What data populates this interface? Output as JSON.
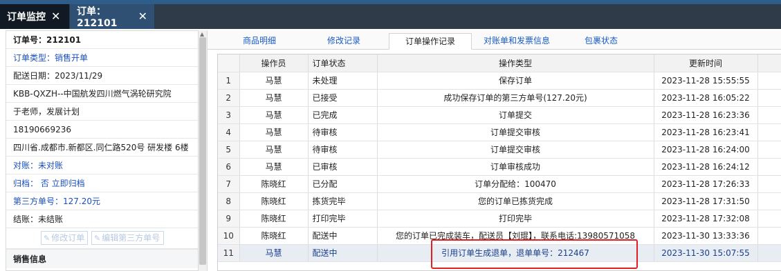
{
  "tabs": [
    {
      "label": "订单监控",
      "close": "✕"
    },
    {
      "label": "订单：212101",
      "close": "✕"
    }
  ],
  "order_info": {
    "order_no": "订单号：212101",
    "order_type": "订单类型：销售开单",
    "delivery_date": "配送日期：2023/11/29",
    "customer": "KBB-QXZH--中国航发四川燃气涡轮研究院",
    "contact": "于老师，发展计划",
    "phone": "18190669236",
    "address": "四川省.成都市.新都区.同仁路520号 研发楼 6楼",
    "reconcile": "对账：未对账",
    "archive": "归档： 否 立即归档",
    "third_party": "第三方单号：127.20元",
    "settle": "结账：未结账",
    "btn_edit_order": "修改订单",
    "btn_edit_third": "编辑第三方单号",
    "section_sales": "销售信息"
  },
  "right_tabs": [
    "商品明细",
    "修改记录",
    "订单操作记录",
    "对账单和发票信息",
    "包裹状态"
  ],
  "active_tab": "订单操作记录",
  "table": {
    "headers": [
      "",
      "操作员",
      "订单状态",
      "操作类型",
      "更新时间"
    ],
    "rows": [
      {
        "idx": "1",
        "operator": "马慧",
        "status": "未处理",
        "action": "保存订单",
        "time": "2023-11-28 15:55:55"
      },
      {
        "idx": "2",
        "operator": "马慧",
        "status": "已接受",
        "action": "成功保存订单的第三方单号(127.20元)",
        "time": "2023-11-28 16:05:22"
      },
      {
        "idx": "3",
        "operator": "马慧",
        "status": "已完成",
        "action": "订单提交",
        "time": "2023-11-28 16:23:36"
      },
      {
        "idx": "4",
        "operator": "马慧",
        "status": "待审核",
        "action": "订单提交审核",
        "time": "2023-11-28 16:23:41"
      },
      {
        "idx": "5",
        "operator": "马慧",
        "status": "待审核",
        "action": "订单提交审核",
        "time": "2023-11-28 16:24:00"
      },
      {
        "idx": "6",
        "operator": "马慧",
        "status": "已审核",
        "action": "订单审核成功",
        "time": "2023-11-28 16:24:12"
      },
      {
        "idx": "7",
        "operator": "陈晓红",
        "status": "已分配",
        "action": "订单分配给：100470",
        "time": "2023-11-28 17:26:33"
      },
      {
        "idx": "8",
        "operator": "陈晓红",
        "status": "拣货完毕",
        "action": "您的订单已拣货完成",
        "time": "2023-11-28 17:31:50"
      },
      {
        "idx": "9",
        "operator": "陈晓红",
        "status": "打印完毕",
        "action": "打印完毕",
        "time": "2023-11-28 17:32:08"
      },
      {
        "idx": "10",
        "operator": "陈晓红",
        "status": "配送中",
        "action": "您的订单已完成装车，配送员【刘琨】，联系电话:13980571058",
        "time": "2023-11-30 13:33:36"
      },
      {
        "idx": "11",
        "operator": "马慧",
        "status": "配送中",
        "action": "引用订单生成退单，退单单号：212467",
        "time": "2023-11-30 15:07:55"
      }
    ]
  },
  "colors": {
    "highlight": "#e02020",
    "tab_active": "#2f4f73",
    "link": "#1a5bc4"
  }
}
